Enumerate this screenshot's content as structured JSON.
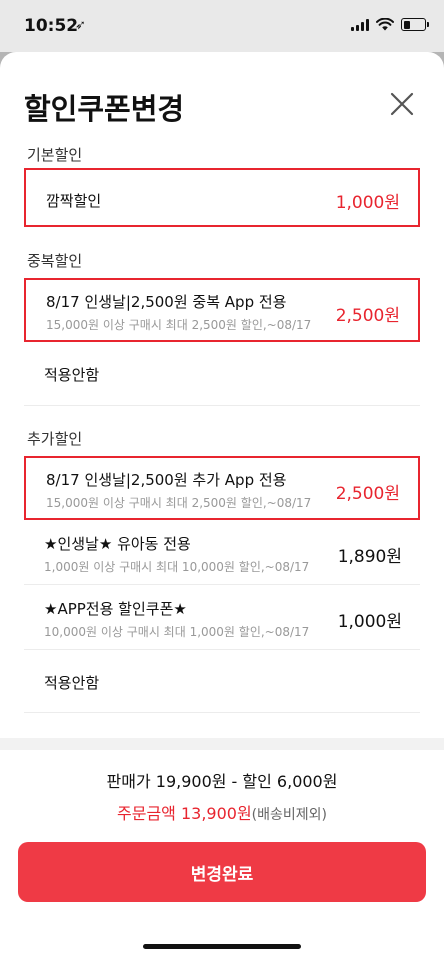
{
  "status_bar": {
    "time": "10:52",
    "location_glyph": "➶"
  },
  "sheet": {
    "title": "할인쿠폰변경"
  },
  "sections": [
    {
      "label": "기본할인",
      "items": [
        {
          "name": "깜짝할인",
          "price": "1,000원",
          "selected": true
        }
      ]
    },
    {
      "label": "중복할인",
      "items": [
        {
          "name": "8/17 인생날|2,500원 중복 App 전용",
          "desc": "15,000원 이상 구매시 최대 2,500원 할인,~08/17",
          "price": "2,500원",
          "selected": true
        },
        {
          "name": "적용안함",
          "selected": false
        }
      ]
    },
    {
      "label": "추가할인",
      "items": [
        {
          "name": "8/17 인생날|2,500원 추가 App 전용",
          "desc": "15,000원 이상 구매시 최대 2,500원 할인,~08/17",
          "price": "2,500원",
          "selected": true
        },
        {
          "name": "★인생날★ 유아동 전용",
          "desc": "1,000원 이상 구매시 최대 10,000원 할인,~08/17",
          "price": "1,890원",
          "selected": false
        },
        {
          "name": "★APP전용 할인쿠폰★",
          "desc": "10,000원 이상 구매시 최대 1,000원 할인,~08/17",
          "price": "1,000원",
          "selected": false
        },
        {
          "name": "적용안함",
          "selected": false
        }
      ]
    }
  ],
  "summary": {
    "line1": "판매가 19,900원 - 할인 6,000원",
    "order_label": "주문금액 13,900원",
    "order_note": "(배송비제외)"
  },
  "confirm_button": "변경완료",
  "colors": {
    "accent": "#e8252f",
    "button": "#ef3a45"
  }
}
